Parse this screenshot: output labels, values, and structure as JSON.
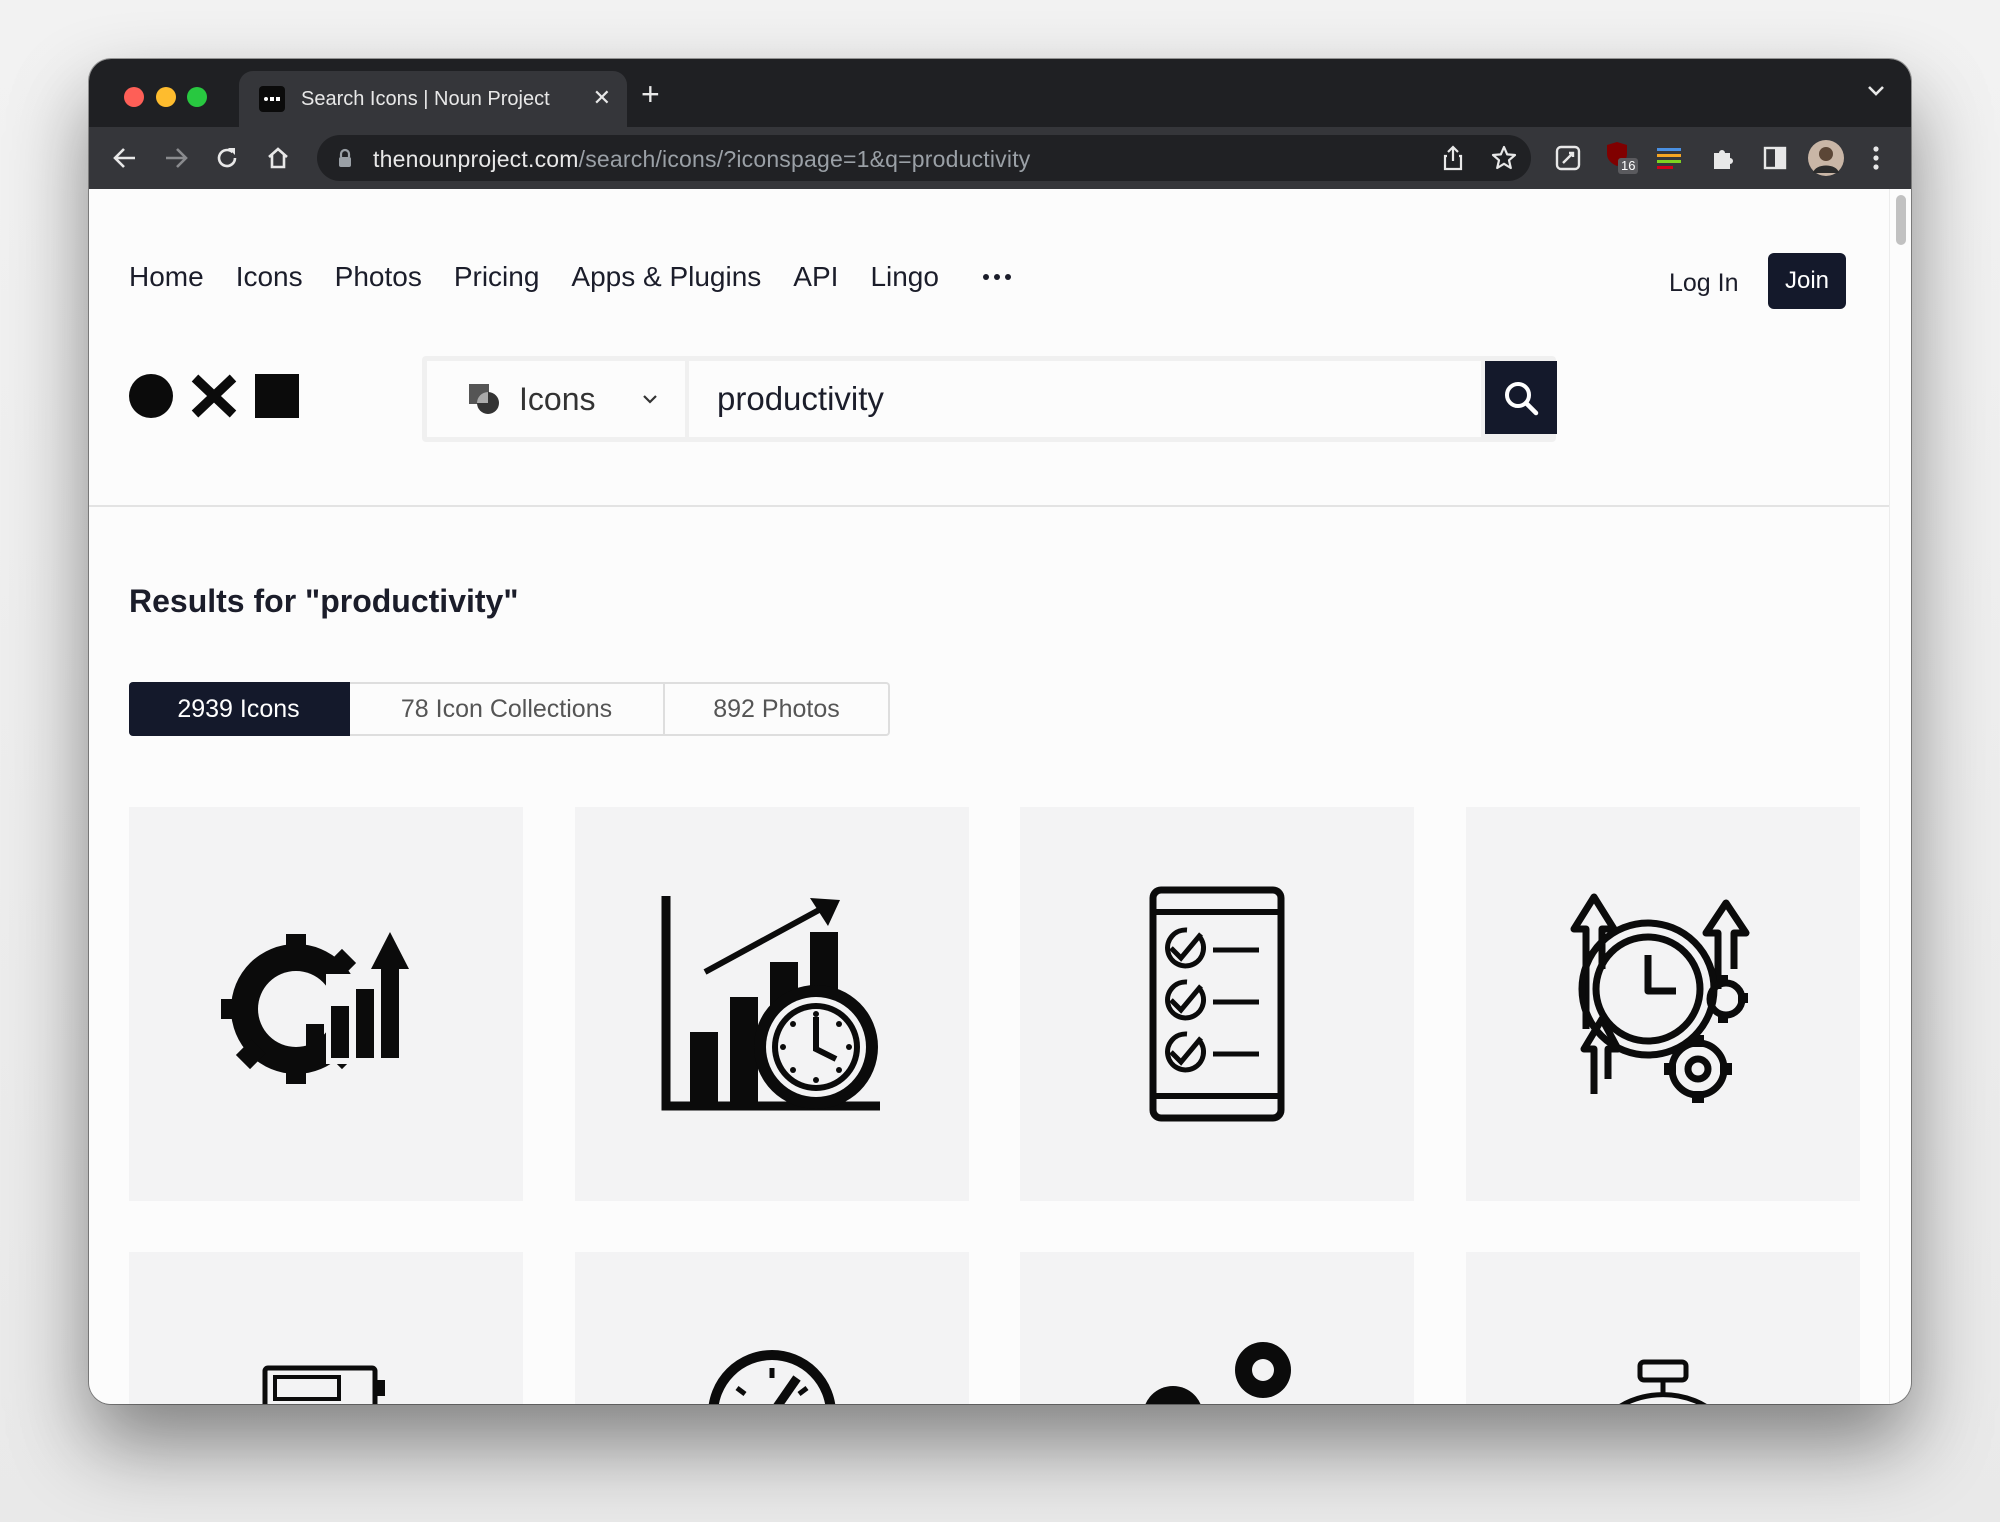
{
  "browser": {
    "tab_title": "Search Icons | Noun Project",
    "tab_close": "✕",
    "new_tab": "+",
    "url_domain": "thenounproject.com",
    "url_path": "/search/icons/?iconspage=1&q=productivity",
    "extension_badge": "16"
  },
  "nav": {
    "links": [
      "Home",
      "Icons",
      "Photos",
      "Pricing",
      "Apps & Plugins",
      "API",
      "Lingo"
    ],
    "login": "Log In",
    "join": "Join"
  },
  "search": {
    "type_label": "Icons",
    "query": "productivity"
  },
  "results": {
    "title": "Results for \"productivity\"",
    "tabs": [
      "2939 Icons",
      "78 Icon Collections",
      "892 Photos"
    ],
    "active_tab": "2939 Icons"
  },
  "icons": [
    "gear-growth-chart-icon",
    "chart-clock-growth-icon",
    "phone-checklist-icon",
    "clock-gears-arrows-icon",
    "battery-icon",
    "speedometer-icon",
    "person-gear-icon",
    "stopwatch-icon"
  ],
  "colors": {
    "dark_navy": "#14192b",
    "chrome_dark": "#1f2023",
    "chrome_toolbar": "#35363a",
    "card_bg": "#f3f3f4"
  }
}
